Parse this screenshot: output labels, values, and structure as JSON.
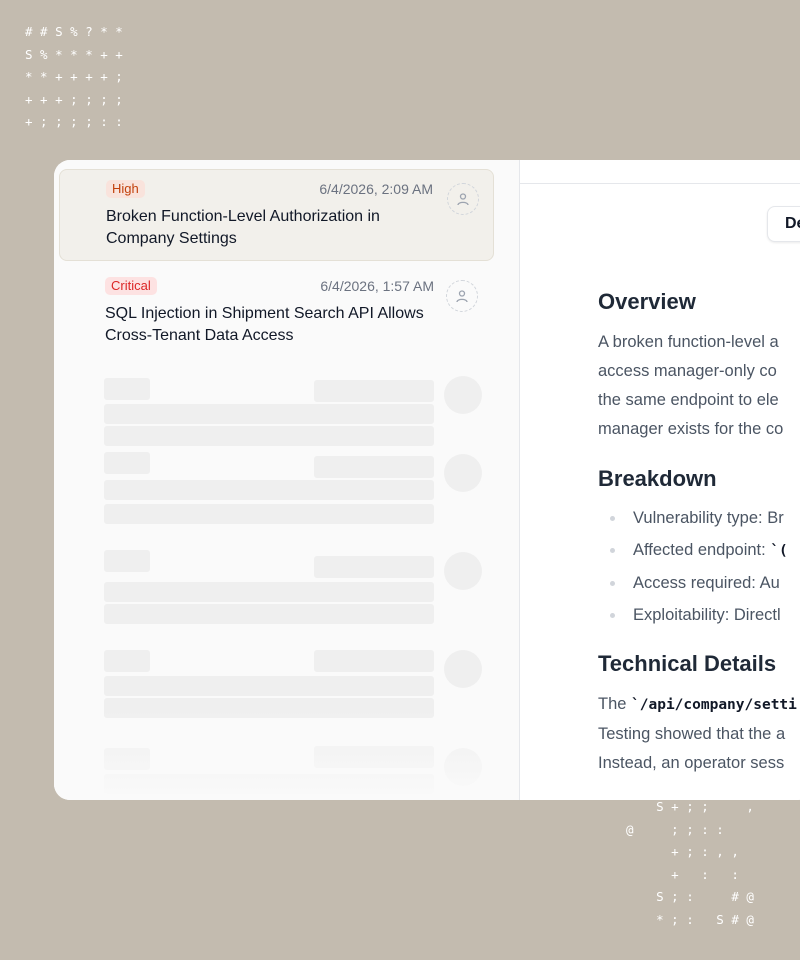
{
  "decor": {
    "ascii_top_left": "# # S % ? * *\nS % * * * + +\n* * + + + + ;\n+ + + ; ; ; ;\n+ ; ; ; ; : :",
    "ascii_bottom_right": "    S + ; ;     ,\n@     ; ; : :\n      + ; : , ,\n      +   :   :\n    S ; :     # @\n    * ; :   S # @"
  },
  "findings": [
    {
      "severity": "High",
      "date": "6/4/2026, 2:09 AM",
      "title": "Broken Function-Level Authorization in Company Settings",
      "selected": true
    },
    {
      "severity": "Critical",
      "date": "6/4/2026, 1:57 AM",
      "title": "SQL Injection in Shipment Search API Allows Cross-Tenant Data Access",
      "selected": false
    }
  ],
  "detail": {
    "tab_label": "De",
    "overview": {
      "heading": "Overview",
      "lines": [
        "A broken function-level a",
        "access manager-only co",
        "the same endpoint to ele",
        "manager exists for the co"
      ]
    },
    "breakdown": {
      "heading": "Breakdown",
      "items": [
        {
          "label": "Vulnerability type: ",
          "value": "Br"
        },
        {
          "label": "Affected endpoint: ",
          "code": "`("
        },
        {
          "label": "Access required: ",
          "value": "Au"
        },
        {
          "label": "Exploitability: ",
          "value": "Directl"
        }
      ]
    },
    "technical": {
      "heading": "Technical Details",
      "line1_prefix": "The ",
      "line1_code": "`/api/company/setti",
      "line2": "Testing showed that the a",
      "line3": "Instead, an operator sess"
    }
  },
  "colors": {
    "background": "#c3bbaf",
    "high": "#c2410c",
    "critical": "#dc2626"
  }
}
